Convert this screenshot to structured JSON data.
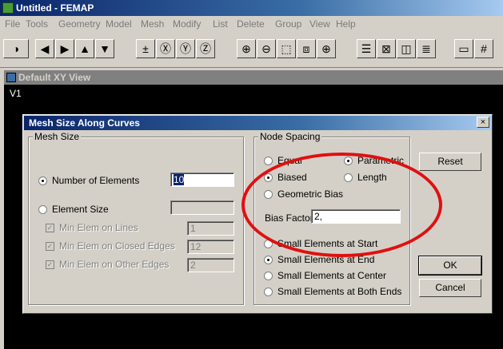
{
  "app": {
    "title": "Untitled - FEMAP"
  },
  "menu": [
    "File",
    "Tools",
    "Geometry",
    "Model",
    "Mesh",
    "Modify",
    "List",
    "Delete",
    "Group",
    "View",
    "Help"
  ],
  "toolbar": {
    "icons": [
      "select-icon",
      "left-arrow-icon",
      "right-arrow-icon",
      "up-arrow-icon",
      "down-arrow-icon",
      "plus-minus-icon",
      "rotate-x-icon",
      "rotate-y-icon",
      "rotate-z-icon",
      "zoom-in-icon",
      "zoom-out-icon",
      "zoom-box-icon",
      "autoscale-icon",
      "center-icon",
      "list-icon",
      "box-icon",
      "3d-box-icon",
      "layers-icon",
      "window-icon",
      "grid-icon"
    ],
    "glyphs": [
      "◑",
      "◀",
      "▶",
      "▲",
      "▼",
      "±",
      "Ⓧ",
      "Ⓨ",
      "Ⓩ",
      "⊕",
      "⊖",
      "⬚",
      "⧈",
      "⊕",
      "☰",
      "⊠",
      "◫",
      "≣",
      "▭",
      "#"
    ]
  },
  "view": {
    "title": "Default XY View",
    "label": "V1"
  },
  "dialog": {
    "title": "Mesh Size Along Curves",
    "close_label": "×",
    "mesh_size": {
      "group_label": "Mesh Size",
      "number_of_elements_label": "Number of Elements",
      "number_of_elements_value": "10",
      "element_size_label": "Element Size",
      "element_size_value": "",
      "min_elem_lines_label": "Min Elem on Lines",
      "min_elem_lines_value": "1",
      "min_elem_closed_label": "Min Elem on Closed Edges",
      "min_elem_closed_value": "12",
      "min_elem_other_label": "Min Elem on Other Edges",
      "min_elem_other_value": "2"
    },
    "node_spacing": {
      "group_label": "Node Spacing",
      "equal_label": "Equal",
      "parametric_label": "Parametric",
      "biased_label": "Biased",
      "length_label": "Length",
      "geometric_bias_label": "Geometric Bias",
      "bias_factor_label": "Bias Factor",
      "bias_factor_value": "2,",
      "small_start_label": "Small Elements at Start",
      "small_end_label": "Small Elements at End",
      "small_center_label": "Small Elements at Center",
      "small_both_label": "Small Elements at Both Ends"
    },
    "buttons": {
      "reset": "Reset",
      "ok": "OK",
      "cancel": "Cancel"
    }
  },
  "highlight": {
    "color": "#e01010"
  }
}
